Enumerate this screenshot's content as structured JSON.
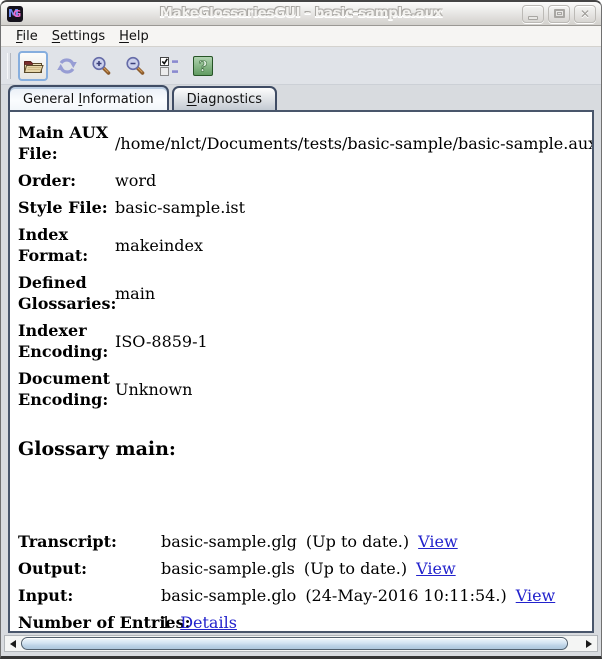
{
  "window": {
    "title": "MakeGlossariesGUI - basic-sample.aux",
    "icon_letters": {
      "m": "M",
      "g": "G"
    },
    "controls": [
      "minimize",
      "maximize",
      "close"
    ]
  },
  "menu": {
    "items": [
      {
        "pre": "",
        "key": "F",
        "post": "ile"
      },
      {
        "pre": "",
        "key": "S",
        "post": "ettings"
      },
      {
        "pre": "",
        "key": "H",
        "post": "elp"
      }
    ]
  },
  "toolbar": {
    "icons": [
      "open-folder-icon",
      "reload-icon",
      "zoom-in-icon",
      "zoom-out-icon",
      "select-entries-icon",
      "help-icon"
    ]
  },
  "tabs": {
    "items": [
      {
        "pre": "General ",
        "key": "I",
        "post": "nformation",
        "active": true
      },
      {
        "pre": "",
        "key": "D",
        "post": "iagnostics",
        "active": false
      }
    ]
  },
  "general": {
    "fields": [
      {
        "label": "Main AUX File:",
        "value": "/home/nlct/Documents/tests/basic-sample/basic-sample.aux"
      },
      {
        "label": "Order:",
        "value": "word"
      },
      {
        "label": "Style File:",
        "value": "basic-sample.ist"
      },
      {
        "label": "Index Format:",
        "value": "makeindex"
      },
      {
        "label": "Defined Glossaries:",
        "value": "main"
      },
      {
        "label": "Indexer Encoding:",
        "value": "ISO-8859-1"
      },
      {
        "label": "Document Encoding:",
        "value": "Unknown"
      }
    ],
    "glossary_heading": "Glossary main:",
    "glossary": [
      {
        "label": "Transcript:",
        "file": "basic-sample.glg",
        "status": "(Up to date.)",
        "link": "View"
      },
      {
        "label": "Output:",
        "file": "basic-sample.gls",
        "status": "(Up to date.)",
        "link": "View"
      },
      {
        "label": "Input:",
        "file": "basic-sample.glo",
        "status": "(24-May-2016 10:11:54.)",
        "link": "View"
      },
      {
        "label": "Number of Entries:",
        "file": "1",
        "status": "",
        "link": "Details"
      }
    ]
  },
  "colors": {
    "link": "#2222cc",
    "focus_ring": "#86aede",
    "help_green": "#6f9f6f",
    "scroll_thumb": "#c6daec",
    "panel_border": "#49566b"
  }
}
